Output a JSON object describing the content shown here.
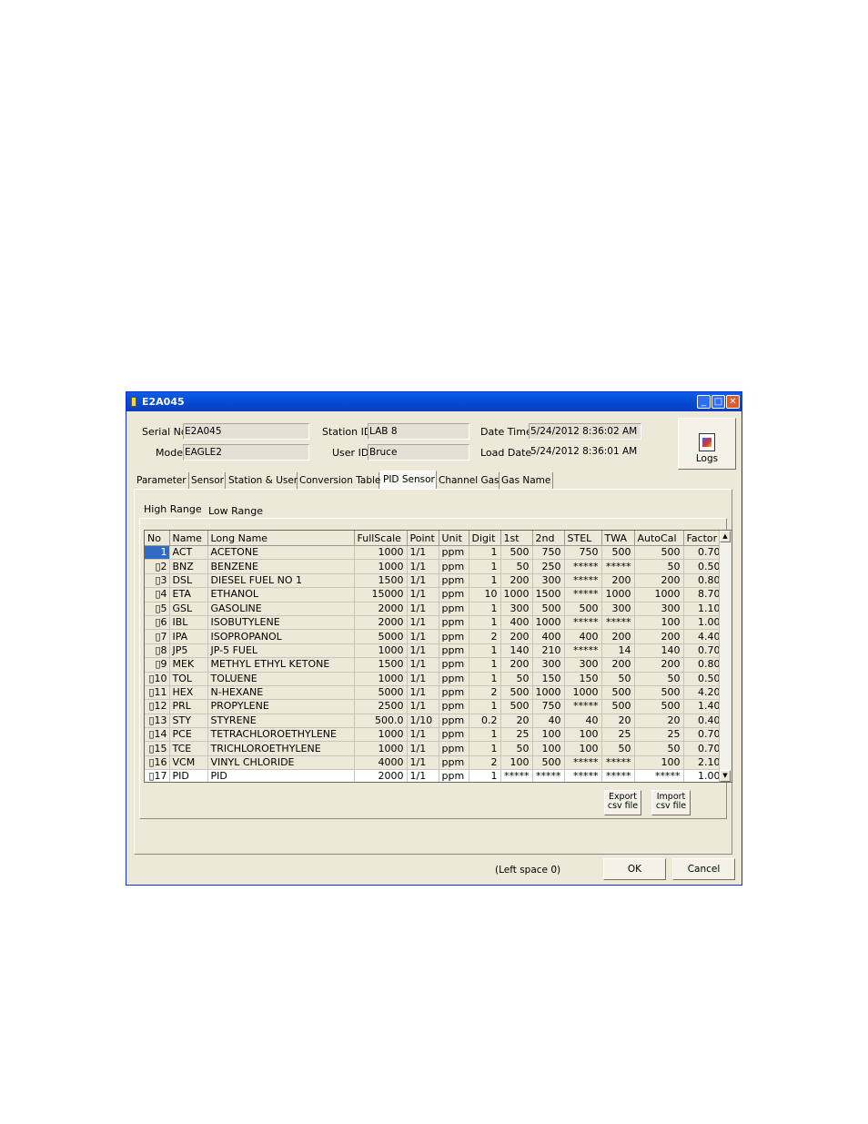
{
  "window": {
    "title": "E2A045",
    "minimize": "_",
    "maximize": "□",
    "close": "✕"
  },
  "header": {
    "serial_label": "Serial No.",
    "serial_value": "E2A045",
    "model_label": "Model",
    "model_value": "EAGLE2",
    "station_label": "Station ID",
    "station_value": "LAB 8",
    "user_label": "User ID",
    "user_value": "Bruce",
    "datetime_label": "Date Time",
    "datetime_value": "5/24/2012 8:36:02 AM",
    "loaddate_label": "Load Date",
    "loaddate_value": "5/24/2012 8:36:01 AM",
    "logs_label": "Logs"
  },
  "tabs": [
    "Parameter",
    "Sensor",
    "Station & User",
    "Conversion Table",
    "PID Sensor",
    "Channel Gas",
    "Gas Name"
  ],
  "active_tab": "PID Sensor",
  "subtabs": [
    "High Range",
    "Low Range"
  ],
  "table": {
    "columns": [
      "No",
      "Name",
      "Long Name",
      "FullScale",
      "Point",
      "Unit",
      "Digit",
      "1st",
      "2nd",
      "STEL",
      "TWA",
      "AutoCal",
      "Factor"
    ],
    "rows": [
      [
        "1",
        "ACT",
        "ACETONE",
        "1000",
        "1/1",
        "ppm",
        "1",
        "500",
        "750",
        "750",
        "500",
        "500",
        "0.70"
      ],
      [
        "▯2",
        "BNZ",
        "BENZENE",
        "1000",
        "1/1",
        "ppm",
        "1",
        "50",
        "250",
        "*****",
        "*****",
        "50",
        "0.50"
      ],
      [
        "▯3",
        "DSL",
        "DIESEL FUEL NO 1",
        "1500",
        "1/1",
        "ppm",
        "1",
        "200",
        "300",
        "*****",
        "200",
        "200",
        "0.80"
      ],
      [
        "▯4",
        "ETA",
        "ETHANOL",
        "15000",
        "1/1",
        "ppm",
        "10",
        "1000",
        "1500",
        "*****",
        "1000",
        "1000",
        "8.70"
      ],
      [
        "▯5",
        "GSL",
        "GASOLINE",
        "2000",
        "1/1",
        "ppm",
        "1",
        "300",
        "500",
        "500",
        "300",
        "300",
        "1.10"
      ],
      [
        "▯6",
        "IBL",
        "ISOBUTYLENE",
        "2000",
        "1/1",
        "ppm",
        "1",
        "400",
        "1000",
        "*****",
        "*****",
        "100",
        "1.00"
      ],
      [
        "▯7",
        "IPA",
        "ISOPROPANOL",
        "5000",
        "1/1",
        "ppm",
        "2",
        "200",
        "400",
        "400",
        "200",
        "200",
        "4.40"
      ],
      [
        "▯8",
        "JP5",
        "JP-5 FUEL",
        "1000",
        "1/1",
        "ppm",
        "1",
        "140",
        "210",
        "*****",
        "14",
        "140",
        "0.70"
      ],
      [
        "▯9",
        "MEK",
        "METHYL ETHYL KETONE",
        "1500",
        "1/1",
        "ppm",
        "1",
        "200",
        "300",
        "300",
        "200",
        "200",
        "0.80"
      ],
      [
        "▯10",
        "TOL",
        "TOLUENE",
        "1000",
        "1/1",
        "ppm",
        "1",
        "50",
        "150",
        "150",
        "50",
        "50",
        "0.50"
      ],
      [
        "▯11",
        "HEX",
        "N-HEXANE",
        "5000",
        "1/1",
        "ppm",
        "2",
        "500",
        "1000",
        "1000",
        "500",
        "500",
        "4.20"
      ],
      [
        "▯12",
        "PRL",
        "PROPYLENE",
        "2500",
        "1/1",
        "ppm",
        "1",
        "500",
        "750",
        "*****",
        "500",
        "500",
        "1.40"
      ],
      [
        "▯13",
        "STY",
        "STYRENE",
        "500.0",
        "1/10",
        "ppm",
        "0.2",
        "20",
        "40",
        "40",
        "20",
        "20",
        "0.40"
      ],
      [
        "▯14",
        "PCE",
        "TETRACHLOROETHYLENE",
        "1000",
        "1/1",
        "ppm",
        "1",
        "25",
        "100",
        "100",
        "25",
        "25",
        "0.70"
      ],
      [
        "▯15",
        "TCE",
        "TRICHLOROETHYLENE",
        "1000",
        "1/1",
        "ppm",
        "1",
        "50",
        "100",
        "100",
        "50",
        "50",
        "0.70"
      ],
      [
        "▯16",
        "VCM",
        "VINYL CHLORIDE",
        "4000",
        "1/1",
        "ppm",
        "2",
        "100",
        "500",
        "*****",
        "*****",
        "100",
        "2.10"
      ],
      [
        "▯17",
        "PID",
        "PID",
        "2000",
        "1/1",
        "ppm",
        "1",
        "*****",
        "*****",
        "*****",
        "*****",
        "*****",
        "1.00"
      ]
    ]
  },
  "buttons": {
    "export": [
      "Export",
      "csv file"
    ],
    "import": [
      "Import",
      "csv file"
    ],
    "ok": "OK",
    "cancel": "Cancel"
  },
  "status": "(Left space 0)"
}
